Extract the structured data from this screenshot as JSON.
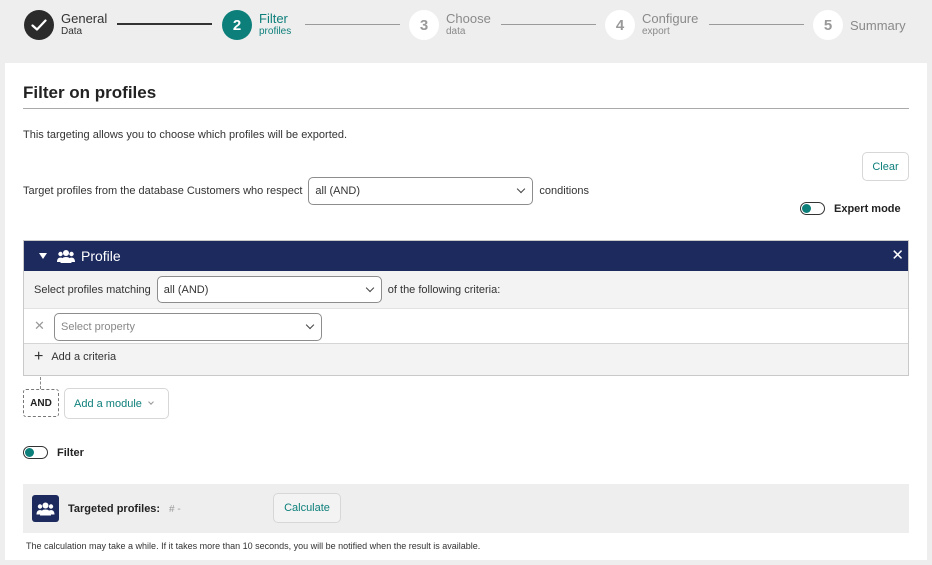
{
  "stepper": {
    "steps": [
      {
        "number": "",
        "title": "General",
        "subtitle": "Data",
        "state": "done"
      },
      {
        "number": "2",
        "title": "Filter",
        "subtitle": "profiles",
        "state": "active"
      },
      {
        "number": "3",
        "title": "Choose",
        "subtitle": "data",
        "state": "todo"
      },
      {
        "number": "4",
        "title": "Configure",
        "subtitle": "export",
        "state": "todo"
      },
      {
        "number": "5",
        "title": "Summary",
        "subtitle": "",
        "state": "todo"
      }
    ]
  },
  "page": {
    "title": "Filter on profiles",
    "intro": "This targeting allows you to choose which profiles will be exported.",
    "clear_label": "Clear",
    "target_prefix": "Target profiles from the database Customers who respect",
    "target_select_value": "all (AND)",
    "target_suffix": "conditions",
    "expert_mode_label": "Expert mode"
  },
  "profile_module": {
    "title": "Profile",
    "close_glyph": "✕",
    "match_prefix": "Select profiles matching",
    "match_select_value": "all (AND)",
    "match_suffix": "of the following criteria:",
    "remove_glyph": "✕",
    "property_placeholder": "Select property",
    "add_criteria_label": "Add a criteria",
    "add_glyph": "+"
  },
  "connector": {
    "and_label": "AND",
    "add_module_label": "Add a module"
  },
  "filter_toggle_label": "Filter",
  "targeted": {
    "label": "Targeted profiles:",
    "value": "# -",
    "calculate_label": "Calculate",
    "note": "The calculation may take a while. If it takes more than 10 seconds, you will be notified when the result is available."
  },
  "colors": {
    "accent": "#0d7f7a",
    "module_header": "#1c2a5e"
  }
}
